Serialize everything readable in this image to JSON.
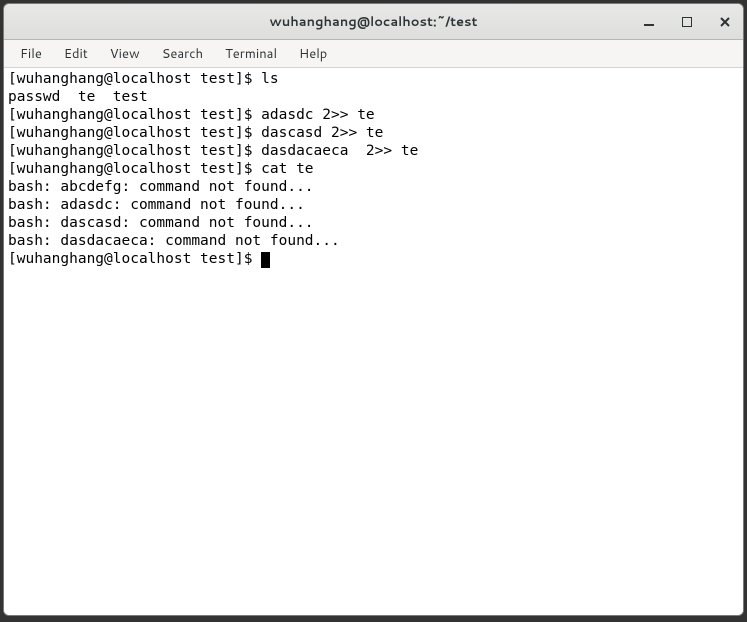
{
  "window": {
    "title": "wuhanghang@localhost:~/test"
  },
  "menubar": {
    "items": [
      "File",
      "Edit",
      "View",
      "Search",
      "Terminal",
      "Help"
    ]
  },
  "terminal": {
    "lines": [
      "[wuhanghang@localhost test]$ ls",
      "passwd  te  test",
      "[wuhanghang@localhost test]$ adasdc 2>> te",
      "[wuhanghang@localhost test]$ dascasd 2>> te",
      "[wuhanghang@localhost test]$ dasdacaeca  2>> te",
      "[wuhanghang@localhost test]$ cat te",
      "bash: abcdefg: command not found...",
      "bash: adasdc: command not found...",
      "bash: dascasd: command not found...",
      "bash: dasdacaeca: command not found...",
      "[wuhanghang@localhost test]$ "
    ]
  }
}
